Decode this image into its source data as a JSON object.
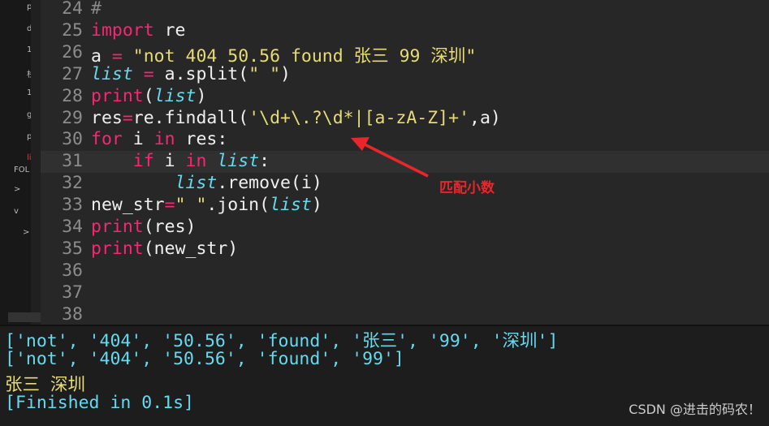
{
  "sidebar": {
    "items": [
      "p",
      "d",
      "1",
      "栈",
      "1",
      "g",
      "p",
      "li"
    ],
    "folders_label": "FOL",
    "tree": [
      ">",
      "v",
      ">"
    ]
  },
  "editor": {
    "lines": [
      {
        "n": "24",
        "html": "<span class='c'>#</span>"
      },
      {
        "n": "25",
        "html": "<span class='k'>import</span> re"
      },
      {
        "n": "26",
        "html": "a <span class='k'>=</span> <span class='s'>\"not 404 50.56 found 张三 99 深圳\"</span>"
      },
      {
        "n": "27",
        "html": "<span class='f'>list</span> <span class='k'>=</span> a.split(<span class='s'>\" \"</span>)"
      },
      {
        "n": "28",
        "html": "<span class='k'>print</span>(<span class='f'>list</span>)"
      },
      {
        "n": "29",
        "html": "res<span class='k'>=</span>re.findall(<span class='s'>'\\d+\\.?\\d*|[a-zA-Z]+'</span>,a)"
      },
      {
        "n": "30",
        "html": "<span class='k'>for</span> i <span class='k'>in</span> res:"
      },
      {
        "n": "31",
        "html": "    <span class='k'>if</span> i <span class='k'>in</span> <span class='f'>list</span>:"
      },
      {
        "n": "32",
        "html": "        <span class='f'>list</span>.remove(i)"
      },
      {
        "n": "33",
        "html": "new_str<span class='k'>=</span><span class='s'>\" \"</span>.join(<span class='f'>list</span>)"
      },
      {
        "n": "34",
        "html": "<span class='k'>print</span>(res)"
      },
      {
        "n": "35",
        "html": "<span class='k'>print</span>(new_str)"
      },
      {
        "n": "36",
        "html": ""
      },
      {
        "n": "37",
        "html": ""
      },
      {
        "n": "38",
        "html": ""
      }
    ],
    "current_line": "31"
  },
  "annotation": {
    "text": "匹配小数",
    "color": "#e8262b"
  },
  "output": {
    "lines": [
      {
        "text": "['not', '404', '50.56', 'found', '张三', '99', '深圳']",
        "color": "#66d9ef"
      },
      {
        "text": "['not', '404', '50.56', 'found', '99']",
        "color": "#66d9ef"
      },
      {
        "text": "张三 深圳",
        "color": "#e6db74"
      },
      {
        "text": "[Finished in 0.1s]",
        "color": "#66d9ef"
      }
    ]
  },
  "watermark": "CSDN @进击的码农！"
}
